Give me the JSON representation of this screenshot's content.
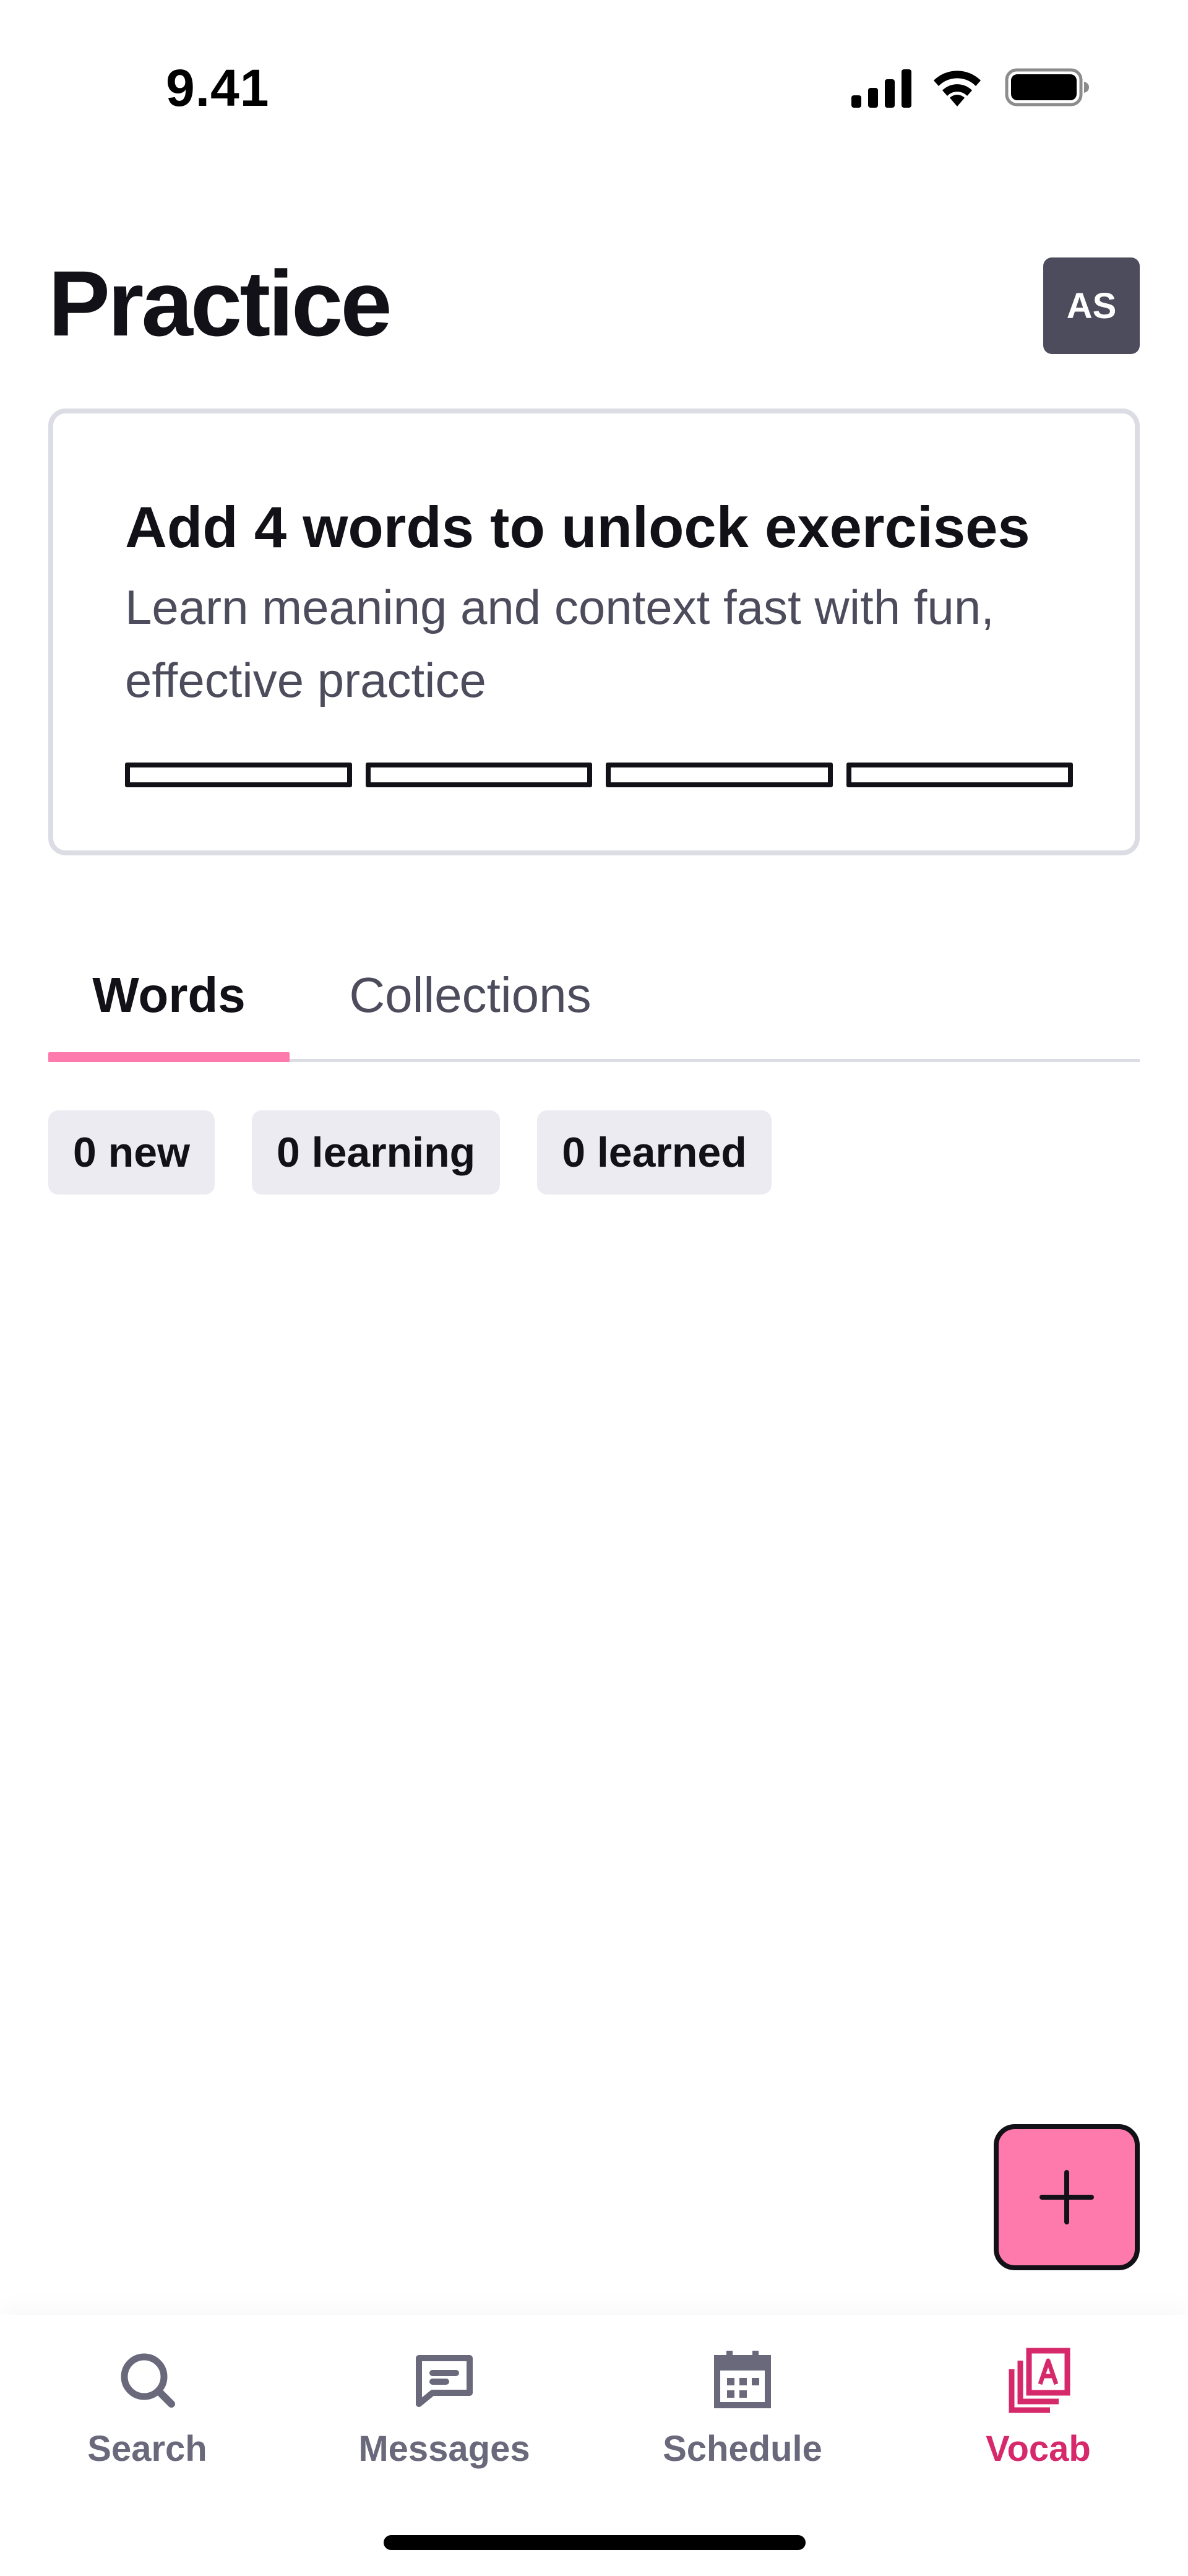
{
  "status_bar": {
    "time": "9.41",
    "icons": [
      "signal-icon",
      "wifi-icon",
      "battery-icon"
    ]
  },
  "header": {
    "title": "Practice",
    "avatar_initials": "AS"
  },
  "unlock_card": {
    "title": "Add 4 words to unlock exercises",
    "subtitle": "Learn meaning and context fast with fun, effective practice",
    "progress_filled": 0,
    "progress_total": 4
  },
  "tabs": [
    {
      "label": "Words",
      "selected": true
    },
    {
      "label": "Collections",
      "selected": false
    }
  ],
  "chips": [
    {
      "label": "0 new"
    },
    {
      "label": "0 learning"
    },
    {
      "label": "0 learned"
    }
  ],
  "fab": {
    "icon": "plus-icon"
  },
  "bottom_nav": [
    {
      "label": "Search",
      "icon": "search-icon",
      "active": false
    },
    {
      "label": "Messages",
      "icon": "message-icon",
      "active": false
    },
    {
      "label": "Schedule",
      "icon": "calendar-icon",
      "active": false
    },
    {
      "label": "Vocab",
      "icon": "vocab-cards-icon",
      "active": true
    }
  ],
  "colors": {
    "accent_pink": "#ff7aac",
    "active_nav": "#d6296b",
    "text_dark": "#121117",
    "text_muted": "#4d4c5c",
    "chip_bg": "#ebebf1",
    "card_border": "#dcdce5"
  }
}
